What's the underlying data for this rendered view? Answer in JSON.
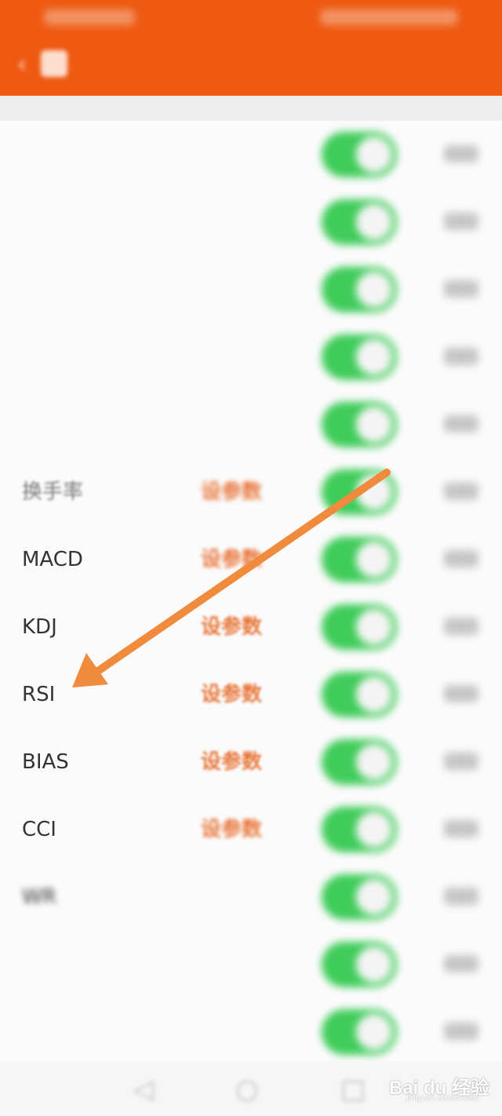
{
  "app_bar": {
    "title": ""
  },
  "header": {
    "columns": [
      "",
      ""
    ]
  },
  "rows": [
    {
      "name": "",
      "param": "",
      "style": "blur-strong",
      "param_plain": true
    },
    {
      "name": "",
      "param": "",
      "style": "blur-strong",
      "param_plain": true
    },
    {
      "name": "",
      "param": "",
      "style": "blur-strong",
      "param_plain": true
    },
    {
      "name": "",
      "param": "",
      "style": "blur-strong",
      "param_plain": true
    },
    {
      "name": "",
      "param": "",
      "style": "blur-strong",
      "param_plain": false
    },
    {
      "name": "换手率",
      "param": "设参数",
      "style": "blur-mid",
      "param_plain": false
    },
    {
      "name": "MACD",
      "param": "设参数",
      "style": "semi",
      "param_plain": false
    },
    {
      "name": "KDJ",
      "param": "设参数",
      "style": "crisp",
      "param_plain": false
    },
    {
      "name": "RSI",
      "param": "设参数",
      "style": "crisp",
      "param_plain": false
    },
    {
      "name": "BIAS",
      "param": "设参数",
      "style": "crisp",
      "param_plain": false
    },
    {
      "name": "CCI",
      "param": "设参数",
      "style": "semi",
      "param_plain": false
    },
    {
      "name": "WR",
      "param": "",
      "style": "blur-strong",
      "param_plain": false
    },
    {
      "name": "",
      "param": "",
      "style": "blur-strong",
      "param_plain": false
    },
    {
      "name": "",
      "param": "",
      "style": "blur-strong",
      "param_plain": false
    }
  ],
  "toggles_on": true,
  "colors": {
    "accent": "#ee5a12",
    "param_text": "#e8763a",
    "toggle_on": "#3fcc5a",
    "annotation_arrow": "#f08a3c"
  },
  "icons": {
    "back": "chevron-left-icon",
    "nav_back": "triangle-back-icon",
    "nav_home": "circle-home-icon",
    "nav_recent": "square-recent-icon"
  },
  "watermark": {
    "text": "Bai du 经验",
    "sub": "jingyan.baidu.com"
  }
}
